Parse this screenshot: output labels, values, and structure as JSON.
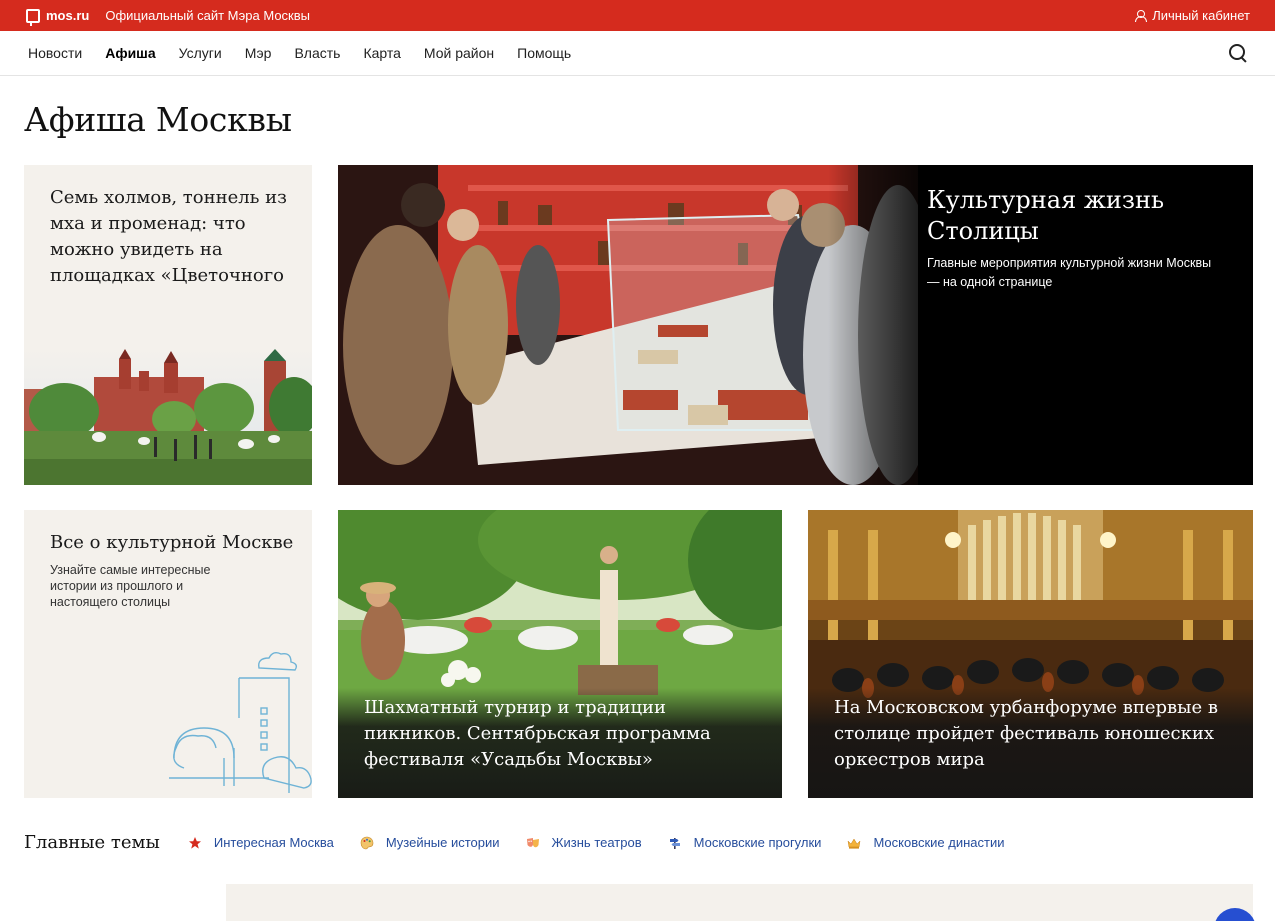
{
  "topbar": {
    "brand": "mos.ru",
    "tagline": "Официальный сайт Мэра Москвы",
    "cabinet": "Личный кабинет"
  },
  "nav": {
    "items": [
      "Новости",
      "Афиша",
      "Услуги",
      "Мэр",
      "Власть",
      "Карта",
      "Мой район",
      "Помощь"
    ],
    "active": "Афиша"
  },
  "page": {
    "title": "Афиша Москвы"
  },
  "cards": {
    "flowers": {
      "title": "Семь холмов, тоннель из мха и променад: что можно увидеть на площадках «Цветочного"
    },
    "culture": {
      "title": "Культурная жизнь Столицы",
      "subtitle": "Главные мероприятия культурной жизни Москвы — на одной странице"
    },
    "about": {
      "title": "Все о культурной Москве",
      "subtitle": "Узнайте самые интересные истории из прошлого и настоящего столицы"
    },
    "chess": {
      "title": "Шахматный турнир и традиции пикников. Сентябрьская программа фестиваля «Усадьбы Москвы»"
    },
    "orchestra": {
      "title": "На Московском урбанфоруме впервые в столице пройдет фестиваль юношеских оркестров мира"
    }
  },
  "themes": {
    "label": "Главные темы",
    "items": [
      {
        "label": "Интересная Москва",
        "icon": "star-icon"
      },
      {
        "label": "Музейные истории",
        "icon": "palette-icon"
      },
      {
        "label": "Жизнь театров",
        "icon": "theatre-masks-icon"
      },
      {
        "label": "Московские прогулки",
        "icon": "signpost-icon"
      },
      {
        "label": "Московские династии",
        "icon": "crown-icon"
      }
    ]
  },
  "colors": {
    "brand_red": "#d52b1e",
    "link_blue": "#264d9c",
    "beige": "#f4f1ec"
  }
}
